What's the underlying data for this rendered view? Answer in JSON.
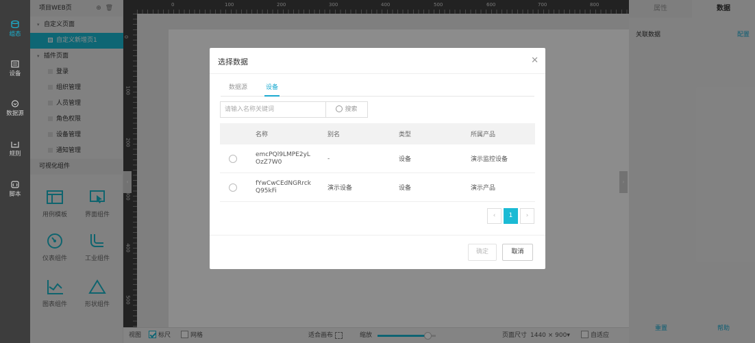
{
  "leftnav": {
    "items": [
      {
        "label": "组态",
        "icon": "database-icon",
        "active": true
      },
      {
        "label": "设备",
        "icon": "device-icon",
        "active": false
      },
      {
        "label": "数据源",
        "icon": "datasource-icon",
        "active": false
      },
      {
        "label": "规则",
        "icon": "rule-icon",
        "active": false
      },
      {
        "label": "脚本",
        "icon": "script-icon",
        "active": false
      }
    ]
  },
  "panel": {
    "title": "项目WEB页",
    "tree": {
      "custom_group": "自定义页面",
      "custom_pages": [
        "自定义新增页1"
      ],
      "plugin_group": "插件页面",
      "plugin_pages": [
        "登录",
        "组织管理",
        "人员管理",
        "角色权限",
        "设备管理",
        "通知管理"
      ]
    },
    "components_title": "可视化组件",
    "components": [
      {
        "label": "用例模板",
        "icon": "template-icon"
      },
      {
        "label": "界面组件",
        "icon": "ui-component-icon"
      },
      {
        "label": "仪表组件",
        "icon": "gauge-icon"
      },
      {
        "label": "工业组件",
        "icon": "pipe-icon"
      },
      {
        "label": "图表组件",
        "icon": "chart-icon"
      },
      {
        "label": "形状组件",
        "icon": "triangle-icon"
      }
    ]
  },
  "ruler": {
    "h_labels": [
      "0",
      "100",
      "200",
      "300",
      "400",
      "500",
      "600",
      "700",
      "800"
    ],
    "v_labels": [
      "0",
      "100",
      "200",
      "300",
      "400",
      "500"
    ]
  },
  "bottombar": {
    "view_label": "视图",
    "ruler_label": "标尺",
    "ruler_checked": true,
    "grid_label": "网格",
    "grid_checked": false,
    "fit_label": "适合画布",
    "zoom_label": "缩放",
    "page_size_label": "页面尺寸",
    "page_size_value": "1440 × 900▾",
    "adaptive_label": "自适应"
  },
  "right": {
    "tabs": [
      "属性",
      "数据"
    ],
    "active_tab": "数据",
    "link_data_label": "关联数据",
    "config_link": "配置",
    "reset_link": "重置",
    "help_link": "帮助"
  },
  "dialog": {
    "title": "选择数据",
    "close": "✕",
    "tabs": [
      "数据源",
      "设备"
    ],
    "active_tab": "设备",
    "search_placeholder": "请输入名称关键词",
    "search_button": "搜索",
    "columns": [
      "名称",
      "别名",
      "类型",
      "所属产品"
    ],
    "rows": [
      {
        "name": "emcPQl9LMPE2yLOzZ7W0",
        "alias": "-",
        "type": "设备",
        "product": "演示监控设备"
      },
      {
        "name": "fYwCwCEdNGRrckQ95kFi",
        "alias": "演示设备",
        "type": "设备",
        "product": "演示产品"
      }
    ],
    "pagination": {
      "prev": "‹",
      "current": "1",
      "next": "›"
    },
    "confirm": "确定",
    "cancel": "取消"
  }
}
